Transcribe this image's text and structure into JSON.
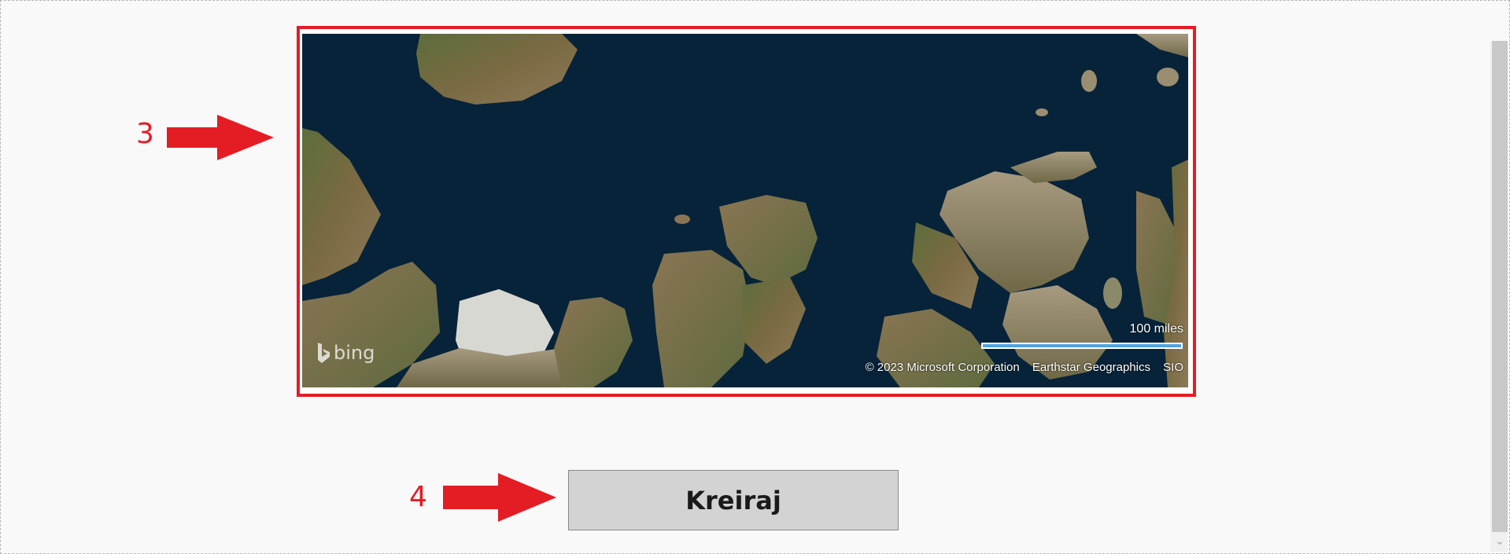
{
  "annotations": {
    "step_map": "3",
    "step_button": "4",
    "color": "#e41c24"
  },
  "map": {
    "provider_logo": "bing",
    "logo_icon": "bing-logo-icon",
    "scale_label": "100 miles",
    "copyright": "© 2023 Microsoft Corporation",
    "attribution_1": "Earthstar Geographics",
    "attribution_2": "SIO",
    "water_color": "#072339",
    "land_color": "#6b6b3a"
  },
  "form": {
    "create_button_label": "Kreiraj"
  }
}
